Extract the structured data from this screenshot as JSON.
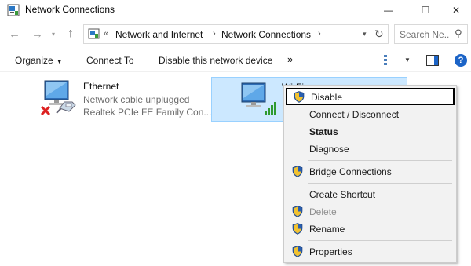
{
  "window": {
    "title": "Network Connections",
    "minimize_glyph": "—",
    "maximize_glyph": "☐",
    "close_glyph": "✕"
  },
  "nav": {
    "back_glyph": "←",
    "forward_glyph": "→",
    "recent_glyph": "▾",
    "up_glyph": "↑",
    "overflow_glyph": "«",
    "breadcrumbs": [
      "Network and Internet",
      "Network Connections"
    ],
    "crumb_separator": "›",
    "dropdown_glyph": "▾",
    "refresh_glyph": "↻",
    "search_placeholder": "Search Ne...",
    "search_glyph": "⚲"
  },
  "command_bar": {
    "organize": "Organize",
    "organize_caret": "▼",
    "connect_to": "Connect To",
    "disable_device": "Disable this network device",
    "more": "»",
    "view_caret": "▼",
    "help": "?"
  },
  "adapters": {
    "ethernet": {
      "name": "Ethernet",
      "status": "Network cable unplugged",
      "device": "Realtek PCIe FE Family Con..."
    },
    "wifi": {
      "name": "Wi-Fi"
    }
  },
  "context_menu": {
    "items": [
      {
        "label": "Disable",
        "shield": true,
        "highlighted": true
      },
      {
        "label": "Connect / Disconnect"
      },
      {
        "label": "Status",
        "bold": true
      },
      {
        "label": "Diagnose"
      },
      {
        "label": "Bridge Connections",
        "shield": true
      },
      {
        "label": "Create Shortcut"
      },
      {
        "label": "Delete",
        "shield": true,
        "disabled": true
      },
      {
        "label": "Rename",
        "shield": true
      },
      {
        "label": "Properties",
        "shield": true
      }
    ]
  },
  "colors": {
    "selection_bg": "#cce8ff",
    "selection_border": "#99d1ff",
    "menu_bg": "#f2f2f2",
    "help_blue": "#1c64c7",
    "muted_text": "#6d6d6d",
    "disabled_text": "#8f8f8f"
  },
  "icons": {
    "app": "network-connections-icon",
    "address": "network-folder-icon",
    "ethernet": "ethernet-adapter-icon",
    "unplugged": "red-x-icon",
    "wifi": "wifi-adapter-icon",
    "signal": "signal-bars-icon",
    "uac": "uac-shield-icon",
    "view": "change-view-icon",
    "preview": "preview-pane-icon"
  }
}
